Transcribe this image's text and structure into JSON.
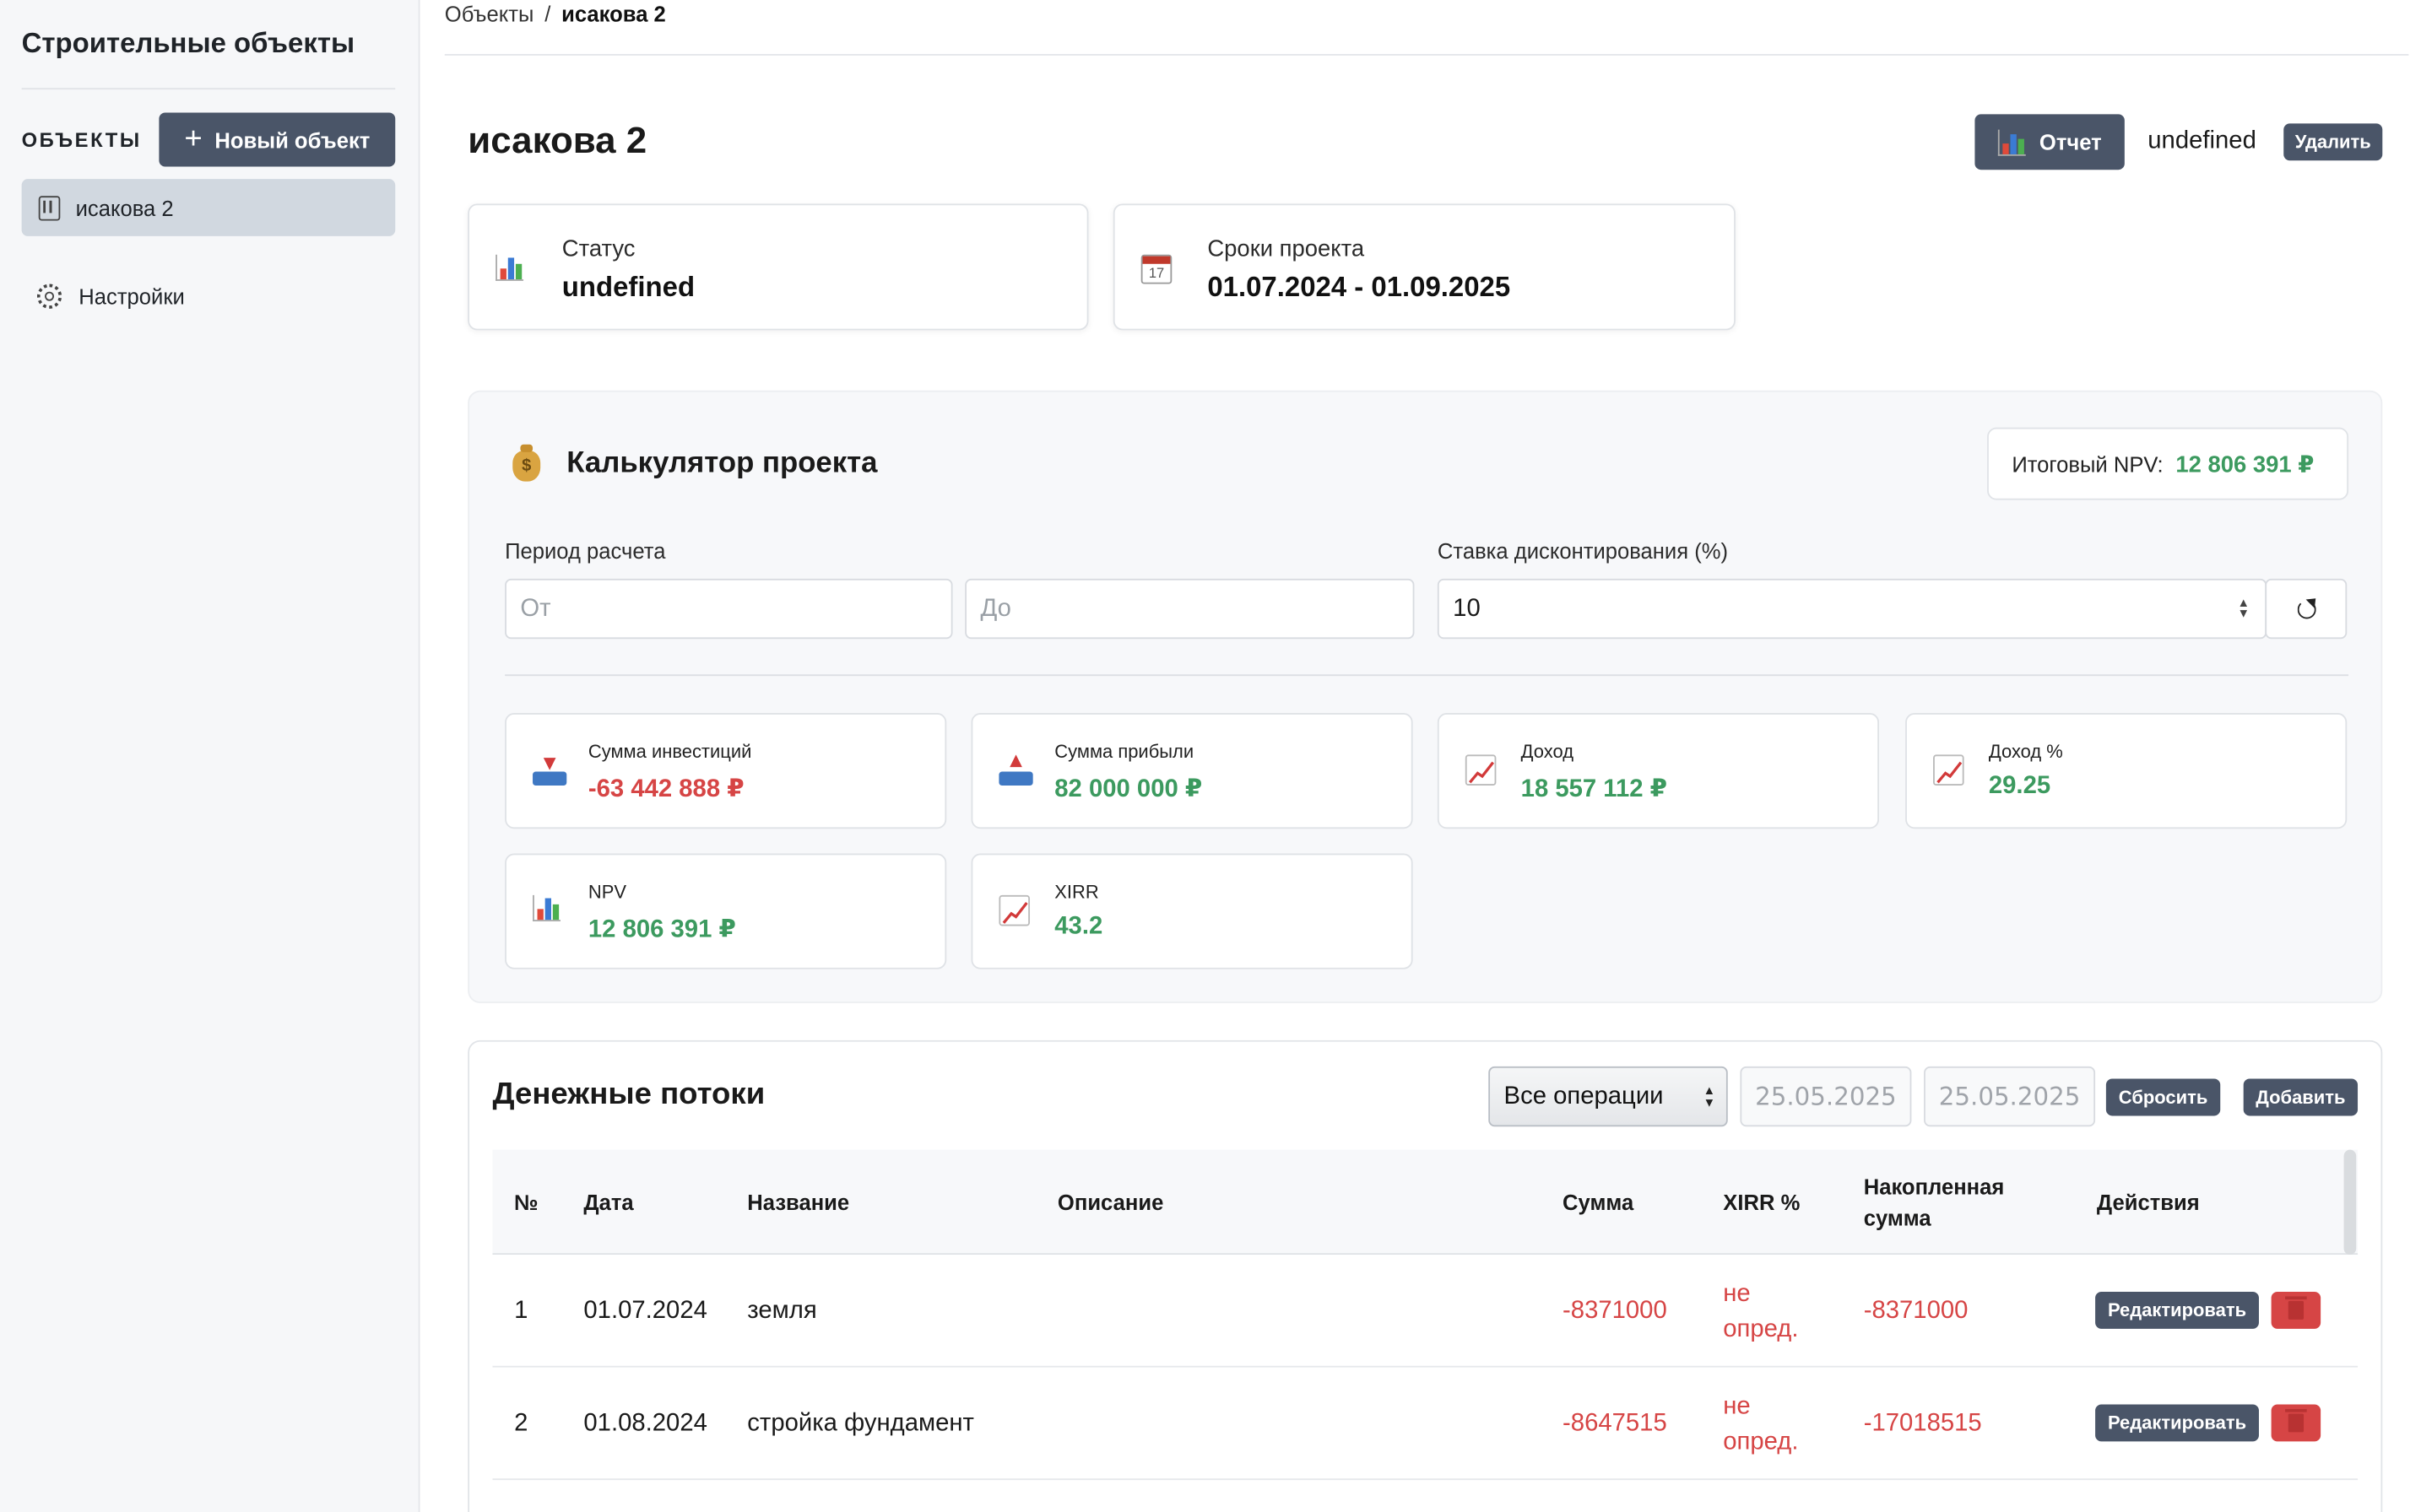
{
  "sidebar": {
    "title": "Строительные объекты",
    "section_label": "ОБЪЕКТЫ",
    "new_object_label": "Новый объект",
    "objects": [
      {
        "label": "исакова 2"
      }
    ],
    "settings_label": "Настройки"
  },
  "breadcrumb": {
    "root": "Объекты",
    "separator": "/",
    "current": "исакова 2"
  },
  "header": {
    "title": "исакова 2",
    "report_label": "Отчет",
    "status_text": "undefined",
    "delete_label": "Удалить"
  },
  "info_cards": {
    "status": {
      "label": "Статус",
      "value": "undefined",
      "icon": "bar-chart-icon"
    },
    "dates": {
      "label": "Сроки проекта",
      "value": "01.07.2024 - 01.09.2025",
      "icon": "calendar-icon",
      "icon_text": "17"
    }
  },
  "calculator": {
    "title": "Калькулятор проекта",
    "icon": "money-bag-icon",
    "npv_label": "Итоговый NPV:",
    "npv_value": "12 806 391 ₽",
    "period_label": "Период расчета",
    "from_placeholder": "От",
    "to_placeholder": "До",
    "rate_label": "Ставка дисконтирования (%)",
    "rate_value": "10",
    "metrics": [
      {
        "label": "Сумма инвестиций",
        "value": "-63 442 888 ₽",
        "tone": "negative",
        "icon": "outbox-tray-icon"
      },
      {
        "label": "Сумма прибыли",
        "value": "82 000 000 ₽",
        "tone": "positive",
        "icon": "inbox-tray-icon"
      },
      {
        "label": "Доход",
        "value": "18 557 112 ₽",
        "tone": "positive",
        "icon": "trend-up-icon"
      },
      {
        "label": "Доход %",
        "value": "29.25",
        "tone": "positive",
        "icon": "trend-up-icon"
      },
      {
        "label": "NPV",
        "value": "12 806 391 ₽",
        "tone": "positive",
        "icon": "bar-chart-icon"
      },
      {
        "label": "XIRR",
        "value": "43.2",
        "tone": "positive",
        "icon": "trend-up-icon"
      }
    ]
  },
  "cash_flows": {
    "title": "Денежные потоки",
    "filter_selected": "Все операции",
    "date_from": "25.05.2025",
    "date_to": "25.05.2025",
    "reset_label": "Сбросить",
    "add_label": "Добавить",
    "columns": [
      "№",
      "Дата",
      "Название",
      "Описание",
      "Сумма",
      "XIRR %",
      "Накопленная сумма",
      "Действия"
    ],
    "rows": [
      {
        "num": "1",
        "date": "01.07.2024",
        "name": "земля",
        "description": "",
        "amount": "-8371000",
        "xirr": "не опред.",
        "cumulative": "-8371000",
        "edit_label": "Редактировать"
      },
      {
        "num": "2",
        "date": "01.08.2024",
        "name": "стройка фундамент",
        "description": "",
        "amount": "-8647515",
        "xirr": "не опред.",
        "cumulative": "-17018515",
        "edit_label": "Редактировать"
      }
    ]
  },
  "colors": {
    "primary_button": "#4a5568",
    "negative": "#d64545",
    "positive": "#3c9a5f",
    "sidebar_bg": "#f6f7f9",
    "active_item": "#d1d8e0"
  }
}
